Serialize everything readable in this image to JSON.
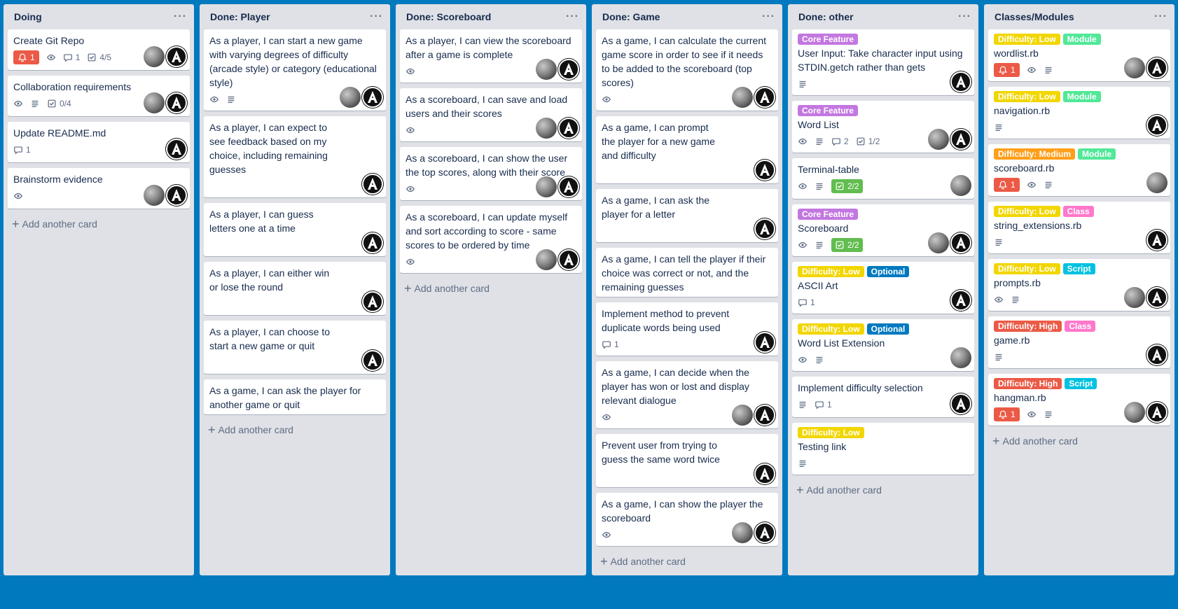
{
  "colors": {
    "board_bg": "#0079bf",
    "list_bg": "#dfe1e6",
    "label_purple": "#c377e0",
    "label_yellow": "#f2d600",
    "label_green": "#61bd4f",
    "label_lime": "#51e898",
    "label_orange": "#ff9f1a",
    "label_pink": "#ff78cb",
    "label_sky": "#00c2e0",
    "label_red": "#eb5a46",
    "label_blue": "#0079bf"
  },
  "add_card_label": "Add another card",
  "list_menu_glyph": "···",
  "lists": [
    {
      "title": "Doing",
      "cards": [
        {
          "title": "Create Git Repo",
          "labels": [],
          "badges": [
            {
              "icon": "bell-icon",
              "text": "1",
              "style": "alert"
            },
            {
              "icon": "eye-icon",
              "text": ""
            },
            {
              "icon": "comment-icon",
              "text": "1"
            },
            {
              "icon": "checklist-icon",
              "text": "4/5"
            }
          ],
          "members": [
            "photo",
            "logo"
          ]
        },
        {
          "title": "Collaboration requirements",
          "labels": [],
          "badges": [
            {
              "icon": "eye-icon",
              "text": ""
            },
            {
              "icon": "description-icon",
              "text": ""
            },
            {
              "icon": "checklist-icon",
              "text": "0/4"
            }
          ],
          "members": [
            "photo",
            "logo"
          ]
        },
        {
          "title": "Update README.md",
          "labels": [],
          "badges": [
            {
              "icon": "comment-icon",
              "text": "1"
            }
          ],
          "members": [
            "logo"
          ]
        },
        {
          "title": "Brainstorm evidence",
          "labels": [],
          "badges": [
            {
              "icon": "eye-icon",
              "text": ""
            }
          ],
          "members": [
            "photo",
            "logo"
          ]
        }
      ]
    },
    {
      "title": "Done: Player",
      "cards": [
        {
          "title": "As a player, I can start a new game with varying degrees of difficulty (arcade style) or category (educational style)",
          "labels": [],
          "badges": [
            {
              "icon": "eye-icon",
              "text": ""
            },
            {
              "icon": "description-icon",
              "text": ""
            }
          ],
          "members": [
            "photo",
            "logo"
          ]
        },
        {
          "title": "As a player, I can expect to see feedback based on my choice, including remaining guesses",
          "labels": [],
          "badges": [],
          "members": [
            "logo"
          ]
        },
        {
          "title": "As a player, I can guess letters one at a time",
          "labels": [],
          "badges": [],
          "members": [
            "logo"
          ]
        },
        {
          "title": "As a player, I can either win or lose the round",
          "labels": [],
          "badges": [],
          "members": [
            "logo"
          ]
        },
        {
          "title": "As a player, I can choose to start a new game or quit",
          "labels": [],
          "badges": [],
          "members": [
            "logo"
          ]
        },
        {
          "title": "As a game, I can ask the player for another game or quit",
          "labels": [],
          "badges": [],
          "members": []
        }
      ]
    },
    {
      "title": "Done: Scoreboard",
      "cards": [
        {
          "title": "As a player, I can view the scoreboard after a game is complete",
          "labels": [],
          "badges": [
            {
              "icon": "eye-icon",
              "text": ""
            }
          ],
          "members": [
            "photo",
            "logo"
          ]
        },
        {
          "title": "As a scoreboard, I can save and load users and their scores",
          "labels": [],
          "badges": [
            {
              "icon": "eye-icon",
              "text": ""
            }
          ],
          "members": [
            "photo",
            "logo"
          ]
        },
        {
          "title": "As a scoreboard, I can show the user the top scores, along with their score",
          "labels": [],
          "badges": [
            {
              "icon": "eye-icon",
              "text": ""
            }
          ],
          "members": [
            "photo",
            "logo"
          ]
        },
        {
          "title": "As a scoreboard, I can update myself and sort according to score - same scores to be ordered by time",
          "labels": [],
          "badges": [
            {
              "icon": "eye-icon",
              "text": ""
            }
          ],
          "members": [
            "photo",
            "logo"
          ]
        }
      ]
    },
    {
      "title": "Done: Game",
      "cards": [
        {
          "title": "As a game, I can calculate the current game score in order to see if it needs to be added to the scoreboard (top scores)",
          "labels": [],
          "badges": [
            {
              "icon": "eye-icon",
              "text": ""
            }
          ],
          "members": [
            "photo",
            "logo"
          ]
        },
        {
          "title": "As a game, I can prompt the player for a new game and difficulty",
          "labels": [],
          "badges": [],
          "members": [
            "logo"
          ]
        },
        {
          "title": "As a game, I can ask the player for a letter",
          "labels": [],
          "badges": [],
          "members": [
            "logo"
          ]
        },
        {
          "title": "As a game, I can tell the player if their choice was correct or not, and the remaining guesses",
          "labels": [],
          "badges": [],
          "members": []
        },
        {
          "title": "Implement method to prevent duplicate words being used",
          "labels": [],
          "badges": [
            {
              "icon": "comment-icon",
              "text": "1"
            }
          ],
          "members": [
            "logo"
          ]
        },
        {
          "title": "As a game, I can decide when the player has won or lost and display relevant dialogue",
          "labels": [],
          "badges": [
            {
              "icon": "eye-icon",
              "text": ""
            }
          ],
          "members": [
            "photo",
            "logo"
          ]
        },
        {
          "title": "Prevent user from trying to guess the same word twice",
          "labels": [],
          "badges": [],
          "members": [
            "logo"
          ]
        },
        {
          "title": "As a game, I can show the player the scoreboard",
          "labels": [],
          "badges": [
            {
              "icon": "eye-icon",
              "text": ""
            }
          ],
          "members": [
            "photo",
            "logo"
          ]
        }
      ]
    },
    {
      "title": "Done: other",
      "cards": [
        {
          "title": "User Input: Take character input using STDIN.getch rather than gets",
          "labels": [
            {
              "text": "Core Feature",
              "color": "#c377e0"
            }
          ],
          "badges": [
            {
              "icon": "description-icon",
              "text": ""
            }
          ],
          "members": [
            "logo"
          ]
        },
        {
          "title": "Word List",
          "labels": [
            {
              "text": "Core Feature",
              "color": "#c377e0"
            }
          ],
          "badges": [
            {
              "icon": "eye-icon",
              "text": ""
            },
            {
              "icon": "description-icon",
              "text": ""
            },
            {
              "icon": "comment-icon",
              "text": "2"
            },
            {
              "icon": "checklist-icon",
              "text": "1/2"
            }
          ],
          "members": [
            "photo",
            "logo"
          ]
        },
        {
          "title": "Terminal-table",
          "labels": [],
          "badges": [
            {
              "icon": "eye-icon",
              "text": ""
            },
            {
              "icon": "description-icon",
              "text": ""
            },
            {
              "icon": "checklist-icon",
              "text": "2/2",
              "style": "done"
            }
          ],
          "members": [
            "photo"
          ]
        },
        {
          "title": "Scoreboard",
          "labels": [
            {
              "text": "Core Feature",
              "color": "#c377e0"
            }
          ],
          "badges": [
            {
              "icon": "eye-icon",
              "text": ""
            },
            {
              "icon": "description-icon",
              "text": ""
            },
            {
              "icon": "checklist-icon",
              "text": "2/2",
              "style": "done"
            }
          ],
          "members": [
            "photo",
            "logo"
          ]
        },
        {
          "title": "ASCII Art",
          "labels": [
            {
              "text": "Difficulty: Low",
              "color": "#f2d600"
            },
            {
              "text": "Optional",
              "color": "#0079bf"
            }
          ],
          "badges": [
            {
              "icon": "comment-icon",
              "text": "1"
            }
          ],
          "members": [
            "logo"
          ]
        },
        {
          "title": "Word List Extension",
          "labels": [
            {
              "text": "Difficulty: Low",
              "color": "#f2d600"
            },
            {
              "text": "Optional",
              "color": "#0079bf"
            }
          ],
          "badges": [
            {
              "icon": "eye-icon",
              "text": ""
            },
            {
              "icon": "description-icon",
              "text": ""
            }
          ],
          "members": [
            "photo"
          ]
        },
        {
          "title": "Implement difficulty selection",
          "labels": [],
          "badges": [
            {
              "icon": "description-icon",
              "text": ""
            },
            {
              "icon": "comment-icon",
              "text": "1"
            }
          ],
          "members": [
            "logo"
          ]
        },
        {
          "title": "Testing link",
          "labels": [
            {
              "text": "Difficulty: Low",
              "color": "#f2d600"
            }
          ],
          "badges": [
            {
              "icon": "description-icon",
              "text": ""
            }
          ],
          "members": []
        }
      ]
    },
    {
      "title": "Classes/Modules",
      "cards": [
        {
          "title": "wordlist.rb",
          "labels": [
            {
              "text": "Difficulty: Low",
              "color": "#f2d600"
            },
            {
              "text": "Module",
              "color": "#51e898"
            }
          ],
          "badges": [
            {
              "icon": "bell-icon",
              "text": "1",
              "style": "alert"
            },
            {
              "icon": "eye-icon",
              "text": ""
            },
            {
              "icon": "description-icon",
              "text": ""
            }
          ],
          "members": [
            "photo",
            "logo"
          ]
        },
        {
          "title": "navigation.rb",
          "labels": [
            {
              "text": "Difficulty: Low",
              "color": "#f2d600"
            },
            {
              "text": "Module",
              "color": "#51e898"
            }
          ],
          "badges": [
            {
              "icon": "description-icon",
              "text": ""
            }
          ],
          "members": [
            "logo"
          ]
        },
        {
          "title": "scoreboard.rb",
          "labels": [
            {
              "text": "Difficulty: Medium",
              "color": "#ff9f1a"
            },
            {
              "text": "Module",
              "color": "#51e898"
            }
          ],
          "badges": [
            {
              "icon": "bell-icon",
              "text": "1",
              "style": "alert"
            },
            {
              "icon": "eye-icon",
              "text": ""
            },
            {
              "icon": "description-icon",
              "text": ""
            }
          ],
          "members": [
            "photo"
          ]
        },
        {
          "title": "string_extensions.rb",
          "labels": [
            {
              "text": "Difficulty: Low",
              "color": "#f2d600"
            },
            {
              "text": "Class",
              "color": "#ff78cb"
            }
          ],
          "badges": [
            {
              "icon": "description-icon",
              "text": ""
            }
          ],
          "members": [
            "logo"
          ]
        },
        {
          "title": "prompts.rb",
          "labels": [
            {
              "text": "Difficulty: Low",
              "color": "#f2d600"
            },
            {
              "text": "Script",
              "color": "#00c2e0"
            }
          ],
          "badges": [
            {
              "icon": "eye-icon",
              "text": ""
            },
            {
              "icon": "description-icon",
              "text": ""
            }
          ],
          "members": [
            "photo",
            "logo"
          ]
        },
        {
          "title": "game.rb",
          "labels": [
            {
              "text": "Difficulty: High",
              "color": "#eb5a46"
            },
            {
              "text": "Class",
              "color": "#ff78cb"
            }
          ],
          "badges": [
            {
              "icon": "description-icon",
              "text": ""
            }
          ],
          "members": [
            "logo"
          ]
        },
        {
          "title": "hangman.rb",
          "labels": [
            {
              "text": "Difficulty: High",
              "color": "#eb5a46"
            },
            {
              "text": "Script",
              "color": "#00c2e0"
            }
          ],
          "badges": [
            {
              "icon": "bell-icon",
              "text": "1",
              "style": "alert"
            },
            {
              "icon": "eye-icon",
              "text": ""
            },
            {
              "icon": "description-icon",
              "text": ""
            }
          ],
          "members": [
            "photo",
            "logo"
          ]
        }
      ]
    }
  ]
}
